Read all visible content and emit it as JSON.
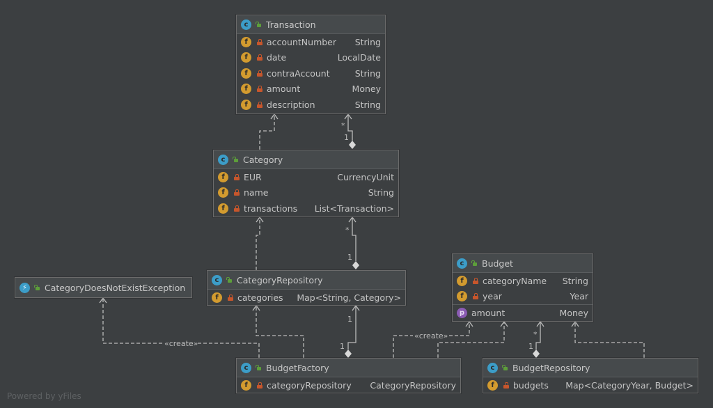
{
  "diagram": {
    "classes": [
      {
        "id": "transaction",
        "name": "Transaction",
        "kind": "class",
        "fields": [
          {
            "name": "accountNumber",
            "type": "String",
            "icon": "field",
            "visibility": "private"
          },
          {
            "name": "date",
            "type": "LocalDate",
            "icon": "field",
            "visibility": "private"
          },
          {
            "name": "contraAccount",
            "type": "String",
            "icon": "field",
            "visibility": "private"
          },
          {
            "name": "amount",
            "type": "Money",
            "icon": "field",
            "visibility": "private"
          },
          {
            "name": "description",
            "type": "String",
            "icon": "field",
            "visibility": "private"
          }
        ],
        "properties": []
      },
      {
        "id": "category",
        "name": "Category",
        "kind": "class",
        "fields": [
          {
            "name": "EUR",
            "type": "CurrencyUnit",
            "icon": "field",
            "visibility": "private"
          },
          {
            "name": "name",
            "type": "String",
            "icon": "field",
            "visibility": "private"
          },
          {
            "name": "transactions",
            "type": "List<Transaction>",
            "icon": "field",
            "visibility": "private"
          }
        ],
        "properties": []
      },
      {
        "id": "categoryRepository",
        "name": "CategoryRepository",
        "kind": "class",
        "fields": [
          {
            "name": "categories",
            "type": "Map<String, Category>",
            "icon": "field",
            "visibility": "private"
          }
        ],
        "properties": []
      },
      {
        "id": "exception",
        "name": "CategoryDoesNotExistException",
        "kind": "exception",
        "fields": [],
        "properties": []
      },
      {
        "id": "budget",
        "name": "Budget",
        "kind": "class",
        "fields": [
          {
            "name": "categoryName",
            "type": "String",
            "icon": "field",
            "visibility": "private"
          },
          {
            "name": "year",
            "type": "Year",
            "icon": "field",
            "visibility": "private"
          }
        ],
        "properties": [
          {
            "name": "amount",
            "type": "Money",
            "icon": "property"
          }
        ]
      },
      {
        "id": "budgetFactory",
        "name": "BudgetFactory",
        "kind": "class",
        "fields": [
          {
            "name": "categoryRepository",
            "type": "CategoryRepository",
            "icon": "field",
            "visibility": "private"
          }
        ],
        "properties": []
      },
      {
        "id": "budgetRepository",
        "name": "BudgetRepository",
        "kind": "class",
        "fields": [
          {
            "name": "budgets",
            "type": "Map<CategoryYear, Budget>",
            "icon": "field",
            "visibility": "private"
          }
        ],
        "properties": []
      }
    ],
    "edges": [
      {
        "from": "category",
        "to": "transaction",
        "type": "dependency"
      },
      {
        "from": "category",
        "to": "transaction",
        "type": "composition",
        "source_mult": "1",
        "target_mult": "*"
      },
      {
        "from": "categoryRepository",
        "to": "category",
        "type": "dependency"
      },
      {
        "from": "categoryRepository",
        "to": "category",
        "type": "composition",
        "source_mult": "1",
        "target_mult": "*"
      },
      {
        "from": "budgetFactory",
        "to": "exception",
        "type": "create",
        "label": "«create»"
      },
      {
        "from": "budgetFactory",
        "to": "categoryRepository",
        "type": "dependency"
      },
      {
        "from": "budgetFactory",
        "to": "categoryRepository",
        "type": "composition",
        "source_mult": "1",
        "target_mult": "1"
      },
      {
        "from": "budgetFactory",
        "to": "budget",
        "type": "create",
        "label": "«create»"
      },
      {
        "from": "budgetFactory",
        "to": "budget",
        "type": "dependency"
      },
      {
        "from": "budgetRepository",
        "to": "budget",
        "type": "composition",
        "source_mult": "1",
        "target_mult": "*"
      },
      {
        "from": "budgetRepository",
        "to": "budget",
        "type": "dependency"
      }
    ],
    "labels": {
      "create": "«create»",
      "one": "1",
      "many": "*"
    }
  },
  "footer": {
    "text": "Powered by yFiles"
  }
}
